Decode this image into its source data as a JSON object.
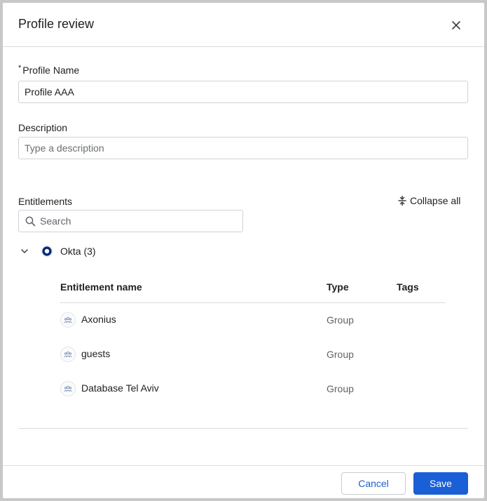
{
  "dialog": {
    "title": "Profile review",
    "close_icon": "close-icon"
  },
  "form": {
    "profile_name": {
      "required_mark": "*",
      "label": "Profile Name",
      "value": "Profile AAA"
    },
    "description": {
      "label": "Description",
      "value": "",
      "placeholder": "Type a description"
    }
  },
  "entitlements": {
    "label": "Entitlements",
    "collapse_all_label": "Collapse all",
    "collapse_icon": "collapse-vertical-icon",
    "search": {
      "placeholder": "Search",
      "icon": "search-icon"
    },
    "group": {
      "expanded": true,
      "chevron_icon": "chevron-down-icon",
      "logo_icon": "okta-logo-icon",
      "label": "Okta (3)",
      "columns": [
        "Entitlement name",
        "Type",
        "Tags"
      ],
      "rows": [
        {
          "icon": "group-icon",
          "name": "Axonius",
          "type": "Group",
          "tags": ""
        },
        {
          "icon": "group-icon",
          "name": "guests",
          "type": "Group",
          "tags": ""
        },
        {
          "icon": "group-icon",
          "name": "Database Tel Aviv",
          "type": "Group",
          "tags": ""
        }
      ]
    }
  },
  "footer": {
    "cancel_label": "Cancel",
    "save_label": "Save"
  },
  "colors": {
    "primary": "#1a5fd6",
    "okta_blue": "#00297a",
    "border": "#cfd3d7",
    "divider": "#dcdcdc"
  }
}
